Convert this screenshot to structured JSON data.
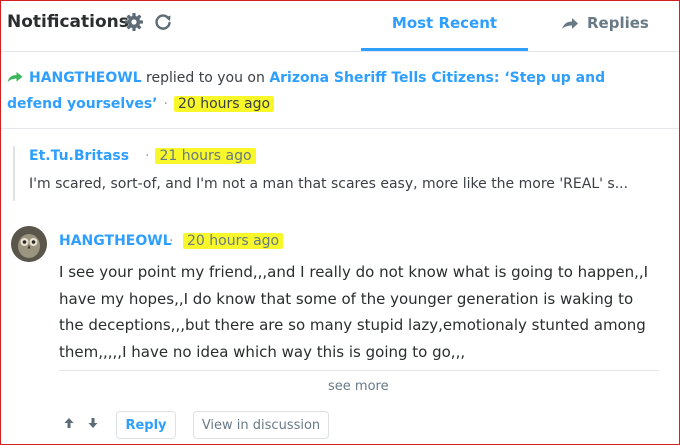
{
  "header": {
    "title": "Notifications",
    "tabs": [
      {
        "label": "Most Recent",
        "active": true
      },
      {
        "label": "Replies",
        "active": false
      }
    ]
  },
  "notification": {
    "user": "HANGTHEOWL",
    "action": " replied to you on ",
    "article": "Arizona Sheriff Tells Citizens: ‘Step up and defend yourselves’",
    "time": "20 hours ago"
  },
  "quoted": {
    "author": "Et.Tu.Britass",
    "time": "21 hours ago",
    "text": "I'm scared, sort-of, and I'm not a man that scares easy, more like the more 'REAL' s..."
  },
  "reply": {
    "author": "HANGTHEOWL",
    "time": "20 hours ago",
    "body": "I see your point my friend,,,and I really do not know what is going to happen,,I have my hopes,,I do know that some of the younger generation is waking to the deceptions,,,but there are so many stupid lazy,emotionaly stunted among them,,,,,I have no idea which way this is going to go,,,"
  },
  "actions": {
    "see_more": "see more",
    "reply": "Reply",
    "view_discussion": "View in discussion"
  },
  "colors": {
    "accent": "#2e9fff",
    "highlight": "#f7f72a",
    "frame": "#d21f1f",
    "share_green": "#3eb55f"
  },
  "icons": [
    "gear-icon",
    "refresh-icon",
    "share-arrow-icon",
    "upvote-icon",
    "downvote-icon",
    "avatar"
  ]
}
